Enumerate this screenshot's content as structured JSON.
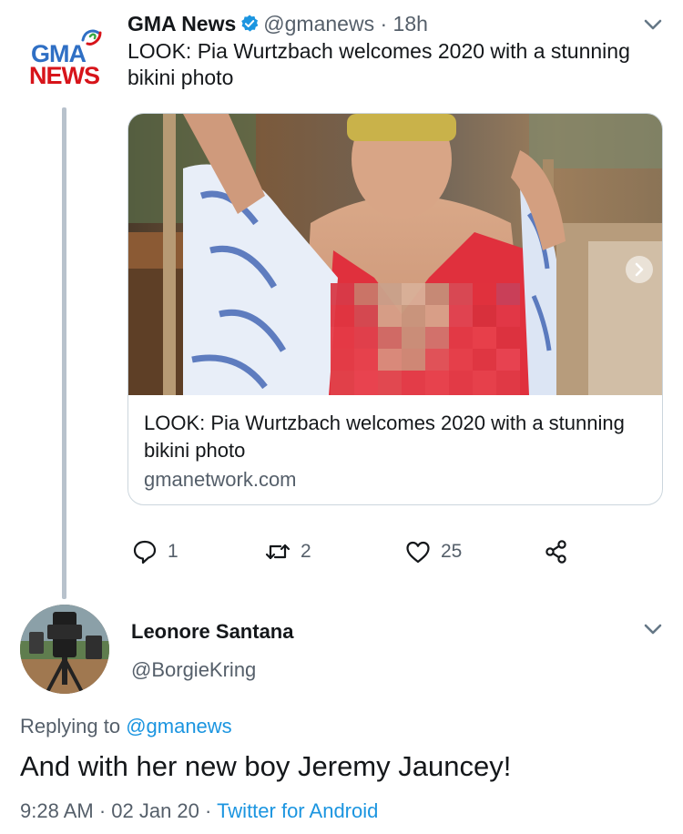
{
  "tweet1": {
    "author_name": "GMA News",
    "avatar_logo_top": "GMA",
    "avatar_logo_bottom": "NEWS",
    "handle": "@gmanews",
    "separator": "·",
    "time": "18h",
    "text": "LOOK: Pia Wurtzbach welcomes 2020 with a stunning bikini photo",
    "card": {
      "title": "LOOK: Pia Wurtzbach welcomes 2020 with a stunning bikini photo",
      "domain": "gmanetwork.com"
    },
    "actions": {
      "reply_count": "1",
      "retweet_count": "2",
      "like_count": "25"
    }
  },
  "tweet2": {
    "author_name": "Leonore Santana",
    "handle": "@BorgieKring",
    "replying_prefix": "Replying to ",
    "replying_to": "@gmanews",
    "text": "And with her new boy Jeremy Jauncey!",
    "timestamp": "9:28 AM · 02 Jan 20 · ",
    "source": "Twitter for Android"
  },
  "icons": {
    "verified": "verified-badge-icon",
    "caret": "chevron-down-icon",
    "reply": "comment-icon",
    "retweet": "retweet-icon",
    "like": "heart-icon",
    "share": "share-icon",
    "carousel": "chevron-right-icon"
  },
  "colors": {
    "link": "#1b95e0",
    "secondary_text": "#555f6a",
    "primary_text": "#14171a",
    "thread_line": "#b8c2cc",
    "gma_blue": "#2f6fc4",
    "gma_red": "#d7141a"
  }
}
